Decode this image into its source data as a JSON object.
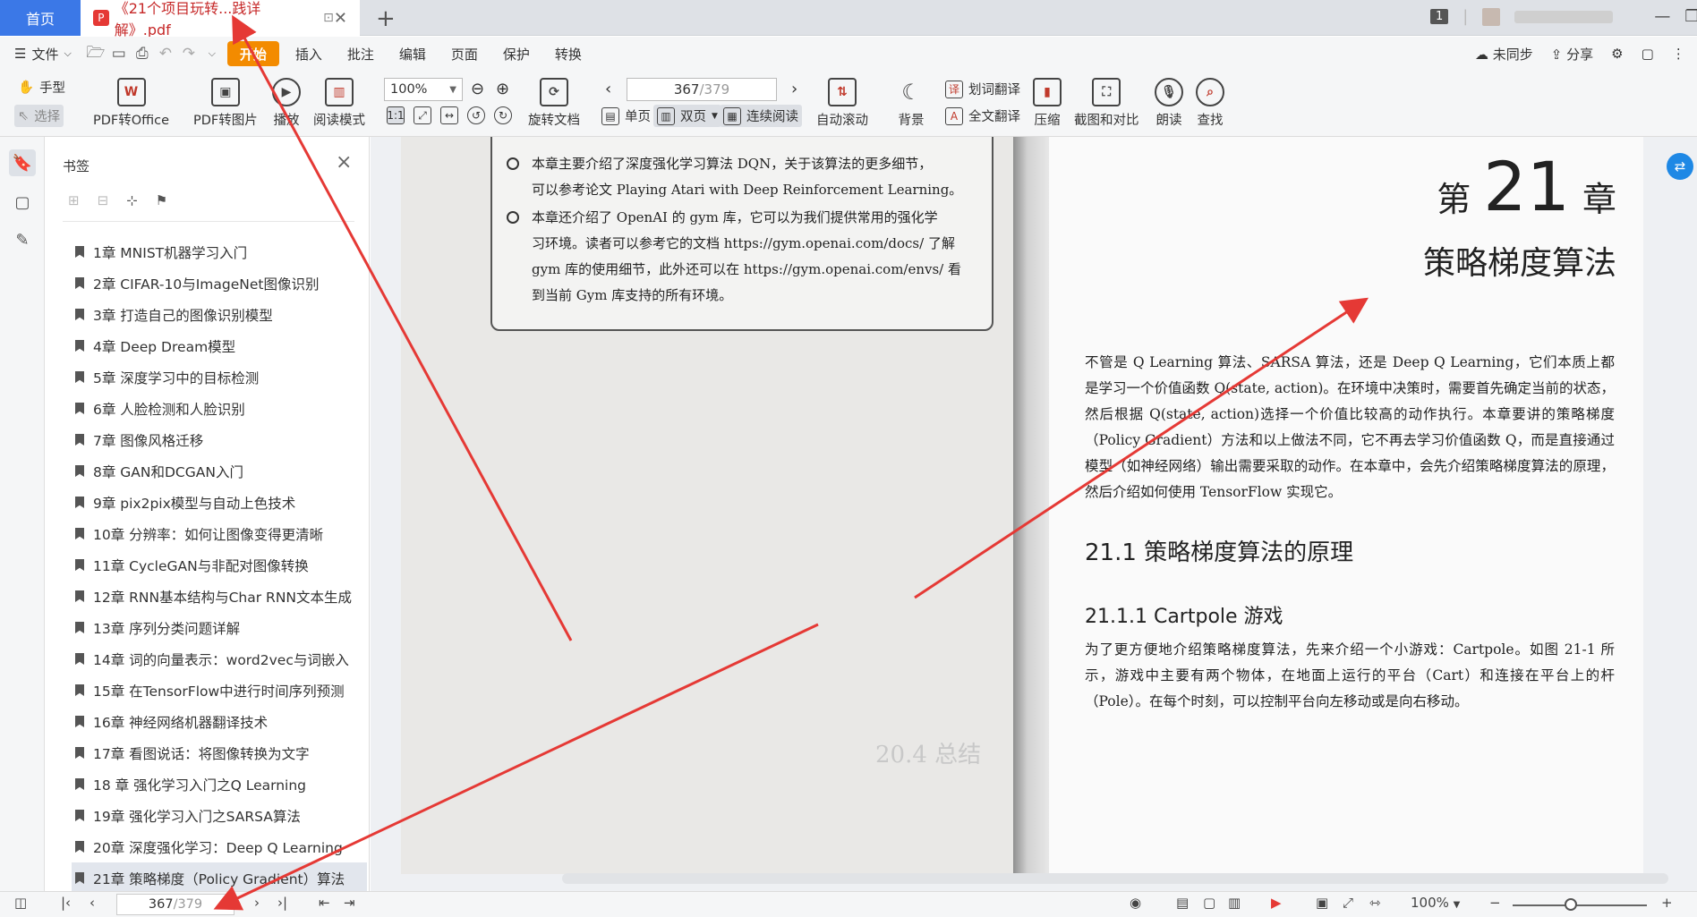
{
  "titlebar": {
    "home_tab": "首页",
    "doc_tab": "《21个项目玩转...践详解》.pdf",
    "doc_badge": "P",
    "close_glyph": "✕",
    "monitor_glyph": "⊡",
    "add_glyph": "+",
    "count_badge": "1"
  },
  "menubar": {
    "file": "文件",
    "items": [
      "开始",
      "插入",
      "批注",
      "编辑",
      "页面",
      "保护",
      "转换"
    ],
    "sync": "未同步",
    "share": "分享"
  },
  "ribbon": {
    "hand": "手型",
    "select": "选择",
    "pdf_to_office": "PDF转Office",
    "pdf_to_image": "PDF转图片",
    "play": "播放",
    "read_mode": "阅读模式",
    "zoom": "100%",
    "page_current": "367",
    "page_total": "/379",
    "rotate": "旋转文档",
    "single": "单页",
    "double": "双页",
    "continuous": "连续阅读",
    "auto_scroll": "自动滚动",
    "background": "背景",
    "word_translate": "划词翻译",
    "full_translate": "全文翻译",
    "compress": "压缩",
    "screenshot_compare": "截图和对比",
    "read_aloud": "朗读",
    "find": "查找"
  },
  "sidebar": {
    "title": "书签",
    "bookmarks": [
      "1章 MNIST机器学习入门",
      "2章 CIFAR-10与ImageNet图像识别",
      "3章 打造自己的图像识别模型",
      "4章 Deep Dream模型",
      "5章 深度学习中的目标检测",
      "6章 人脸检测和人脸识别",
      "7章 图像风格迁移",
      "8章 GAN和DCGAN入门",
      "9章 pix2pix模型与自动上色技术",
      "10章 分辨率：如何让图像变得更清晰",
      "11章 CycleGAN与非配对图像转换",
      "12章 RNN基本结构与Char RNN文本生成",
      "13章 序列分类问题详解",
      "14章 词的向量表示：word2vec与词嵌入",
      "15章 在TensorFlow中进行时间序列预测",
      "16章 神经网络机器翻译技术",
      "17章 看图说话：将图像转换为文字",
      "18 章 强化学习入门之Q Learning",
      "19章 强化学习入门之SARSA算法",
      "20章 深度强化学习：Deep Q Learning",
      "21章 策略梯度（Policy Gradient）算法"
    ]
  },
  "left_page": {
    "note1_line1": "本章主要介绍了深度强化学习算法 DQN，关于该算法的更多细节，",
    "note1_line2": "可以参考论文 Playing Atari with Deep Reinforcement Learning。",
    "note2_line1": "本章还介绍了 OpenAI 的 gym 库，它可以为我们提供常用的强化学",
    "note2_line2": "习环境。读者可以参考它的文档 https://gym.openai.com/docs/ 了解",
    "note2_line3": "gym 库的使用细节，此外还可以在 https://gym.openai.com/envs/ 看",
    "note2_line4": "到当前 Gym 库支持的所有环境。",
    "ghost_heading": "20.4 总结"
  },
  "right_page": {
    "chapter_word1": "第",
    "chapter_num": "21",
    "chapter_word2": "章",
    "chapter_title": "策略梯度算法",
    "intro": "不管是 Q Learning 算法、SARSA 算法，还是 Deep Q Learning，它们本质上都是学习一个价值函数 Q(state, action)。在环境中决策时，需要首先确定当前的状态，然后根据 Q(state, action)选择一个价值比较高的动作执行。本章要讲的策略梯度（Policy Gradient）方法和以上做法不同，它不再去学习价值函数 Q，而是直接通过模型（如神经网络）输出需要采取的动作。在本章中，会先介绍策略梯度算法的原理，然后介绍如何使用 TensorFlow 实现它。",
    "section": "21.1 策略梯度算法的原理",
    "subsection": "21.1.1 Cartpole 游戏",
    "body": "为了更方便地介绍策略梯度算法，先来介绍一个小游戏：Cartpole。如图 21-1 所示，游戏中主要有两个物体，在地面上运行的平台（Cart）和连接在平台上的杆（Pole）。在每个时刻，可以控制平台向左移动或是向右移动。"
  },
  "statusbar": {
    "page_current": "367",
    "page_total": "/379",
    "zoom": "100%"
  },
  "colors": {
    "accent": "#3b78e7",
    "menu_active": "#f38b00",
    "annotation_red": "#e53935"
  }
}
